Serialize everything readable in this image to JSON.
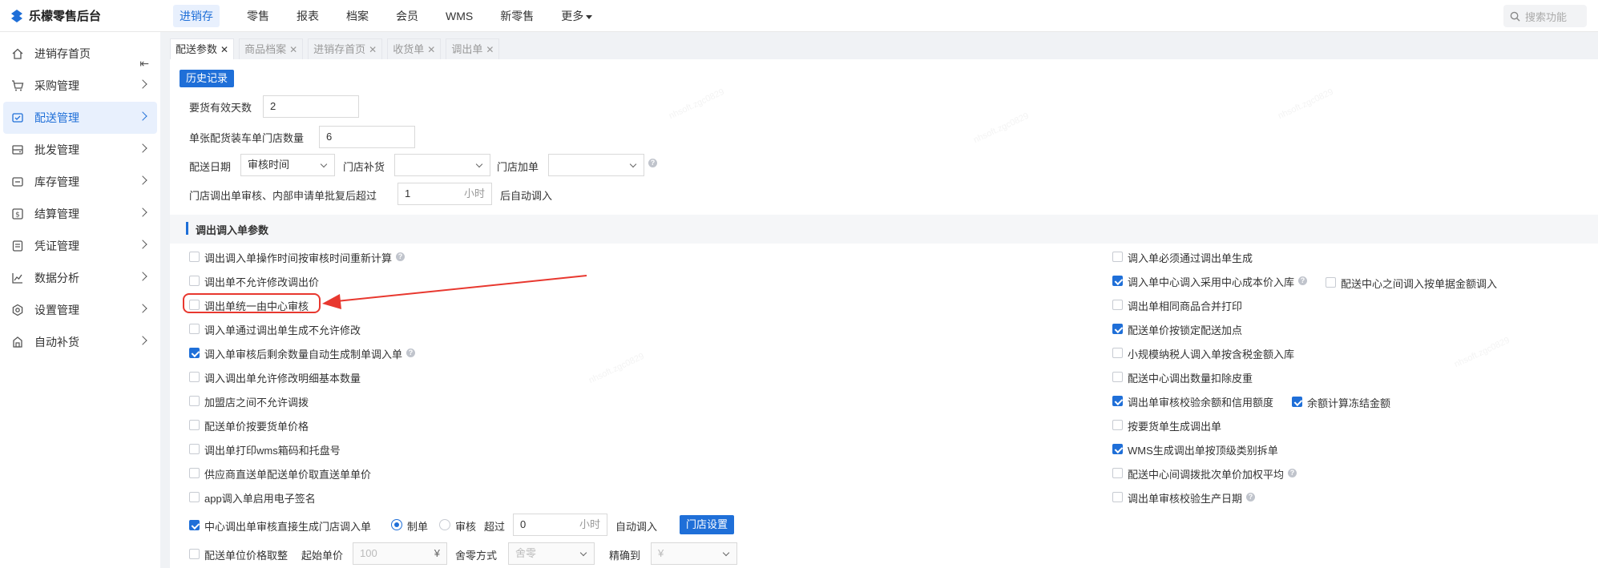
{
  "app": {
    "title": "乐檬零售后台"
  },
  "nav": {
    "items": [
      "进销存",
      "零售",
      "报表",
      "档案",
      "会员",
      "WMS",
      "新零售",
      "更多"
    ],
    "search_placeholder": "搜索功能"
  },
  "sidebar": {
    "items": [
      {
        "label": "进销存首页",
        "icon": "home-icon"
      },
      {
        "label": "采购管理",
        "icon": "cart-icon"
      },
      {
        "label": "配送管理",
        "icon": "truck-icon"
      },
      {
        "label": "批发管理",
        "icon": "wholesale-icon"
      },
      {
        "label": "库存管理",
        "icon": "inventory-icon"
      },
      {
        "label": "结算管理",
        "icon": "dollar-icon"
      },
      {
        "label": "凭证管理",
        "icon": "document-icon"
      },
      {
        "label": "数据分析",
        "icon": "chart-icon"
      },
      {
        "label": "设置管理",
        "icon": "settings-icon"
      },
      {
        "label": "自动补货",
        "icon": "replenish-icon"
      }
    ],
    "active": "配送管理"
  },
  "tabs": [
    "配送参数",
    "商品档案",
    "进销存首页",
    "收货单",
    "调出单"
  ],
  "content": {
    "history_button": "历史记录",
    "valid_days_label": "要货有效天数",
    "valid_days_value": "2",
    "truck_stores_label": "单张配货装车单门店数量",
    "truck_stores_value": "6",
    "delivery_date_label": "配送日期",
    "delivery_date_value": "审核时间",
    "store_replenish_label": "门店补货",
    "store_add_label": "门店加单",
    "auto_in_label": "门店调出单审核、内部申请单批复后超过",
    "auto_in_value": "1",
    "auto_in_unit": "小时",
    "auto_in_suffix": "后自动调入",
    "section_title": "调出调入单参数",
    "left_options": [
      {
        "label": "调出调入单操作时间按审核时间重新计算",
        "checked": false,
        "help": true
      },
      {
        "label": "调出单不允许修改调出价",
        "checked": false,
        "help": false
      },
      {
        "label": "调出单统一由中心审核",
        "checked": false,
        "help": false
      },
      {
        "label": "调入单通过调出单生成不允许修改",
        "checked": false,
        "help": false
      },
      {
        "label": "调入单审核后剩余数量自动生成制单调入单",
        "checked": true,
        "help": true
      },
      {
        "label": "调入调出单允许修改明细基本数量",
        "checked": false,
        "help": false
      },
      {
        "label": "加盟店之间不允许调拨",
        "checked": false,
        "help": false
      },
      {
        "label": "配送单价按要货单价格",
        "checked": false,
        "help": false
      },
      {
        "label": "调出单打印wms箱码和托盘号",
        "checked": false,
        "help": false
      },
      {
        "label": "供应商直送单配送单价取直送单单价",
        "checked": false,
        "help": false
      },
      {
        "label": "app调入单启用电子签名",
        "checked": false,
        "help": false
      }
    ],
    "right_options": [
      {
        "label": "调入单必须通过调出单生成",
        "checked": false,
        "help": false
      },
      {
        "label": "调入单中心调入采用中心成本价入库",
        "checked": true,
        "help": true
      },
      {
        "label": "调出单相同商品合并打印",
        "checked": false,
        "help": false
      },
      {
        "label": "配送单价按锁定配送加点",
        "checked": true,
        "help": false
      },
      {
        "label": "小规模纳税人调入单按含税金额入库",
        "checked": false,
        "help": false
      },
      {
        "label": "配送中心调出数量扣除皮重",
        "checked": false,
        "help": false
      },
      {
        "label": "调出单审核校验余额和信用额度",
        "checked": true,
        "help": false
      },
      {
        "label": "按要货单生成调出单",
        "checked": false,
        "help": false
      },
      {
        "label": "WMS生成调出单按顶级类别拆单",
        "checked": true,
        "help": false
      },
      {
        "label": "配送中心间调拨批次单价加权平均",
        "checked": false,
        "help": true
      },
      {
        "label": "调出单审核校验生产日期",
        "checked": false,
        "help": true
      }
    ],
    "extra_right_1": {
      "label": "配送中心之间调入按单据金额调入",
      "checked": false
    },
    "extra_right_2": {
      "label": "余额计算冻结金额",
      "checked": true
    },
    "center_row": {
      "label": "中心调出单审核直接生成门店调入单",
      "checked": true,
      "radio1": "制单",
      "radio2": "审核",
      "over_label": "超过",
      "hours_value": "0",
      "hours_unit": "小时",
      "auto_label": "自动调入",
      "store_setting_button": "门店设置"
    },
    "price_row": {
      "label": "配送单位价格取整",
      "checked": false,
      "start_price_label": "起始单价",
      "start_price_placeholder": "100",
      "currency": "¥",
      "rounding_label": "舍零方式",
      "rounding_value": "舍零",
      "precision_label": "精确到",
      "precision_value": "¥"
    }
  },
  "colors": {
    "accent": "#1f6fd8",
    "highlight": "#e8382f"
  }
}
